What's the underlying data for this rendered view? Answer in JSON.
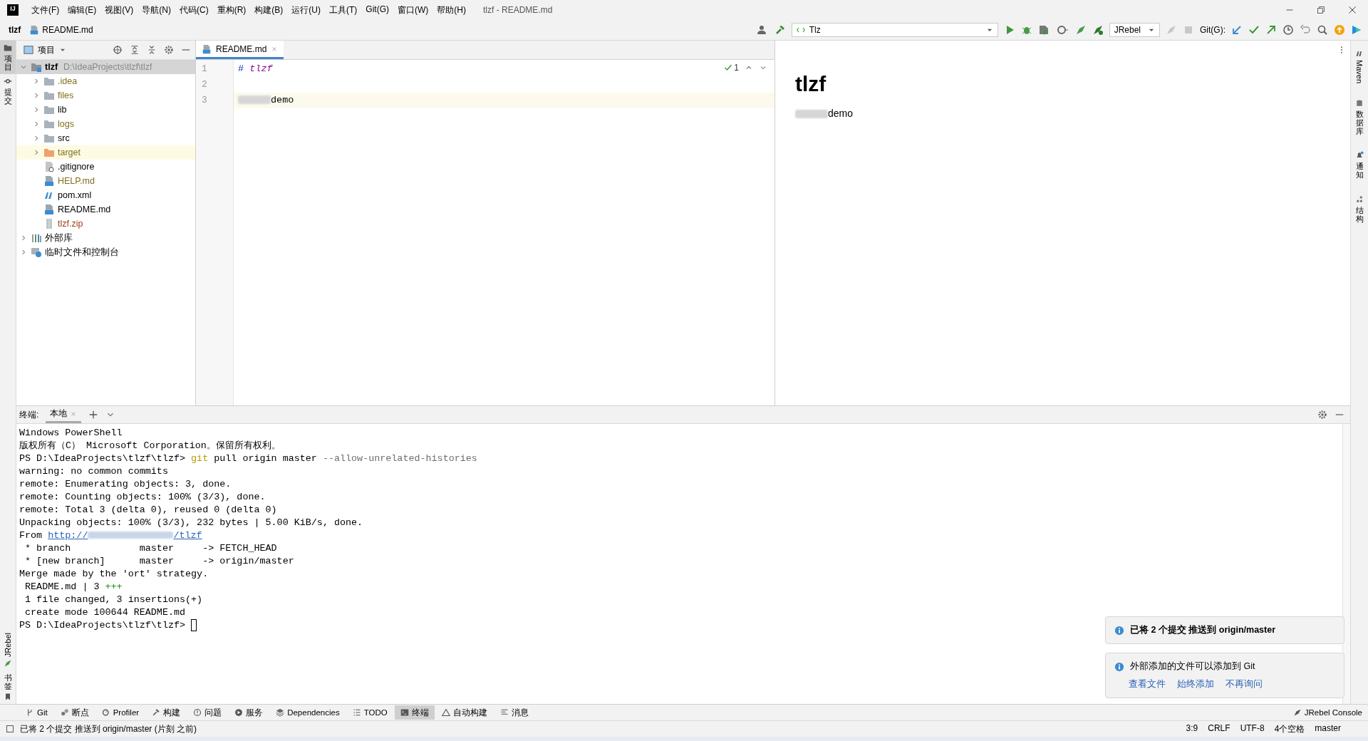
{
  "window": {
    "logo": "IJ",
    "title": "tlzf - README.md"
  },
  "menu": [
    "文件(F)",
    "编辑(E)",
    "视图(V)",
    "导航(N)",
    "代码(C)",
    "重构(R)",
    "构建(B)",
    "运行(U)",
    "工具(T)",
    "Git(G)",
    "窗口(W)",
    "帮助(H)"
  ],
  "breadcrumb": [
    {
      "label": "tlzf",
      "kind": "project"
    },
    {
      "label": "README.md",
      "kind": "file"
    }
  ],
  "toolbar": {
    "run_config": "Tlz",
    "jrebel": "JRebel",
    "git_label": "Git(G):"
  },
  "left_strip": {
    "top": [
      {
        "label": "项目",
        "rotated": false,
        "kind": "folder",
        "selected": true
      },
      {
        "label": "提交",
        "rotated": false,
        "kind": "commit",
        "selected": false
      }
    ],
    "bottom": [
      {
        "label": "JRebel",
        "rotated": true,
        "kind": "jrebel",
        "selected": false
      },
      {
        "label": "书签",
        "rotated": false,
        "kind": "bookmark",
        "selected": false
      }
    ]
  },
  "right_strip": [
    {
      "label": "Maven",
      "rotated": true,
      "kind": "maven"
    },
    {
      "label": "数据库",
      "rotated": false,
      "kind": "database"
    },
    {
      "label": "通知",
      "rotated": false,
      "kind": "bell"
    },
    {
      "label": "结构",
      "rotated": false,
      "kind": "structure"
    }
  ],
  "project": {
    "title": "项目",
    "tree": [
      {
        "label": "tlzf",
        "path": "D:\\IdeaProjects\\tlzf\\tlzf",
        "kind": "module",
        "expanded": true,
        "selected": true,
        "highlighted": false,
        "children": [
          {
            "label": ".idea",
            "kind": "folder",
            "color": "#826f1c",
            "expanded": false,
            "selected": false,
            "highlighted": false
          },
          {
            "label": "files",
            "kind": "folder",
            "color": "#826f1c",
            "expanded": false,
            "selected": false,
            "highlighted": false
          },
          {
            "label": "lib",
            "kind": "folder",
            "expanded": false,
            "selected": false,
            "highlighted": false
          },
          {
            "label": "logs",
            "kind": "folder",
            "color": "#826f1c",
            "expanded": false,
            "selected": false,
            "highlighted": false
          },
          {
            "label": "src",
            "kind": "folder",
            "expanded": false,
            "selected": false,
            "highlighted": false
          },
          {
            "label": "target",
            "kind": "excluded",
            "color": "#826f1c",
            "expanded": false,
            "selected": false,
            "highlighted": true
          },
          {
            "label": ".gitignore",
            "kind": "ignore",
            "selected": false,
            "highlighted": false
          },
          {
            "label": "HELP.md",
            "kind": "markdown",
            "color": "#826f1c",
            "selected": false,
            "highlighted": false
          },
          {
            "label": "pom.xml",
            "kind": "maven",
            "selected": false,
            "highlighted": false
          },
          {
            "label": "README.md",
            "kind": "markdown",
            "selected": false,
            "highlighted": false
          },
          {
            "label": "tlzf.zip",
            "kind": "archive",
            "color": "#9c3d17",
            "selected": false,
            "highlighted": false
          }
        ]
      },
      {
        "label": "外部库",
        "kind": "libraries",
        "expanded": false,
        "selected": false,
        "highlighted": false
      },
      {
        "label": "临时文件和控制台",
        "kind": "scratches",
        "expanded": false,
        "selected": false,
        "highlighted": false
      }
    ]
  },
  "editor": {
    "tabs": [
      {
        "label": "README.md",
        "selected": true
      }
    ],
    "inspection": "1",
    "lines": [
      {
        "number": "1",
        "current": false,
        "segments": [
          {
            "kind": "heading_mark",
            "text": "#"
          },
          {
            "kind": "heading",
            "text": " tlzf"
          }
        ]
      },
      {
        "number": "2",
        "current": false
      },
      {
        "number": "3",
        "current": true,
        "segments": [
          {
            "kind": "redacted"
          },
          {
            "kind": "text",
            "text": "demo"
          }
        ]
      }
    ]
  },
  "preview": {
    "heading": "tlzf",
    "paragraph": [
      {
        "kind": "redacted"
      },
      {
        "kind": "text",
        "text": "demo"
      }
    ]
  },
  "terminal": {
    "label": "终端:",
    "tabs": [
      {
        "label": "本地",
        "selected": true
      }
    ],
    "lines": [
      [
        {
          "kind": "text",
          "text": "Windows PowerShell"
        }
      ],
      [
        {
          "kind": "text",
          "text": "版权所有（C） Microsoft Corporation。保留所有权利。"
        }
      ],
      [
        {
          "kind": "text",
          "text": "PS D:\\IdeaProjects\\tlzf\\tlzf> "
        },
        {
          "kind": "command",
          "text": "git"
        },
        {
          "kind": "text",
          "text": " pull origin master "
        },
        {
          "kind": "option",
          "text": "--allow-unrelated-histories"
        }
      ],
      [
        {
          "kind": "text",
          "text": "warning: no common commits"
        }
      ],
      [
        {
          "kind": "text",
          "text": "remote: Enumerating objects: 3, done."
        }
      ],
      [
        {
          "kind": "text",
          "text": "remote: Counting objects: 100% (3/3), done."
        }
      ],
      [
        {
          "kind": "text",
          "text": "remote: Total 3 (delta 0), reused 0 (delta 0)"
        }
      ],
      [
        {
          "kind": "text",
          "text": "Unpacking objects: 100% (3/3), 232 bytes | 5.00 KiB/s, done."
        }
      ],
      [
        {
          "kind": "text",
          "text": "From "
        },
        {
          "kind": "link",
          "text": "http://",
          "after": "/tlzf"
        }
      ],
      [
        {
          "kind": "text",
          "text": " * branch            master     -> FETCH_HEAD"
        }
      ],
      [
        {
          "kind": "text",
          "text": " * [new branch]      master     -> origin/master"
        }
      ],
      [
        {
          "kind": "text",
          "text": "Merge made by the 'ort' strategy."
        }
      ],
      [
        {
          "kind": "text",
          "text": " README.md | 3 "
        },
        {
          "kind": "added",
          "text": "+++"
        }
      ],
      [
        {
          "kind": "text",
          "text": " 1 file changed, 3 insertions(+)"
        }
      ],
      [
        {
          "kind": "text",
          "text": " create mode 100644 README.md"
        }
      ],
      [
        {
          "kind": "text",
          "text": "PS D:\\IdeaProjects\\tlzf\\tlzf> "
        },
        {
          "kind": "cursor"
        }
      ]
    ]
  },
  "notifications": [
    {
      "title": "已将 2 个提交 推送到 origin/master",
      "emphasis": true
    },
    {
      "title": "外部添加的文件可以添加到 Git",
      "emphasis": false,
      "actions": [
        "查看文件",
        "始终添加",
        "不再询问"
      ]
    }
  ],
  "tool_buttons": [
    {
      "label": "Git",
      "kind": "git",
      "selected": false
    },
    {
      "label": "断点",
      "kind": "breakpoints",
      "selected": false
    },
    {
      "label": "Profiler",
      "kind": "profiler",
      "selected": false
    },
    {
      "label": "构建",
      "kind": "build",
      "selected": false
    },
    {
      "label": "问题",
      "kind": "problems",
      "selected": false
    },
    {
      "label": "服务",
      "kind": "services",
      "selected": false
    },
    {
      "label": "Dependencies",
      "kind": "dependencies",
      "selected": false
    },
    {
      "label": "TODO",
      "kind": "todo",
      "selected": false
    },
    {
      "label": "终端",
      "kind": "terminal",
      "selected": true
    },
    {
      "label": "自动构建",
      "kind": "autobuild",
      "selected": false
    },
    {
      "label": "消息",
      "kind": "messages",
      "selected": false
    }
  ],
  "jrebel_console": "JRebel Console",
  "status_bar": {
    "message": "已将 2 个提交 推送到 origin/master (片刻 之前)",
    "items": [
      "3:9",
      "CRLF",
      "UTF-8",
      "4个空格",
      "master"
    ]
  }
}
